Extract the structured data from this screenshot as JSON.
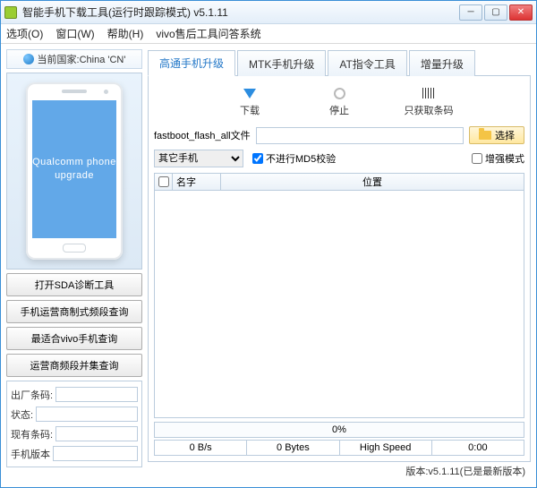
{
  "title": "智能手机下载工具(运行时跟踪模式)  v5.1.11",
  "menu": {
    "options": "选项(O)",
    "window": "窗口(W)",
    "help": "帮助(H)",
    "vivo": "vivo售后工具问答系统"
  },
  "country": {
    "label": "当前国家:China 'CN'"
  },
  "phone_screen": {
    "line1": "Qualcomm phone",
    "line2": "upgrade"
  },
  "sidebar_buttons": {
    "b1": "打开SDA诊断工具",
    "b2": "手机运营商制式频段查询",
    "b3": "最适合vivo手机查询",
    "b4": "运营商频段并集查询"
  },
  "info": {
    "factory_barcode": "出厂条码:",
    "status1": "状态:",
    "current_barcode": "现有条码:",
    "phone_version": "手机版本"
  },
  "tabs": {
    "t1": "高通手机升级",
    "t2": "MTK手机升级",
    "t3": "AT指令工具",
    "t4": "增量升级"
  },
  "actions": {
    "download": "下载",
    "stop": "停止",
    "barcode_only": "只获取条码"
  },
  "file": {
    "label": "fastboot_flash_all文件",
    "choose": "选择"
  },
  "opts": {
    "device_sel": "其它手机",
    "no_md5": "不进行MD5校验",
    "enhance": "增强模式"
  },
  "table": {
    "name": "名字",
    "location": "位置"
  },
  "progress": "0%",
  "status": {
    "speed": "0 B/s",
    "bytes": "0 Bytes",
    "mode": "High Speed",
    "time": "0:00"
  },
  "version_line": "版本:v5.1.11(已是最新版本)"
}
